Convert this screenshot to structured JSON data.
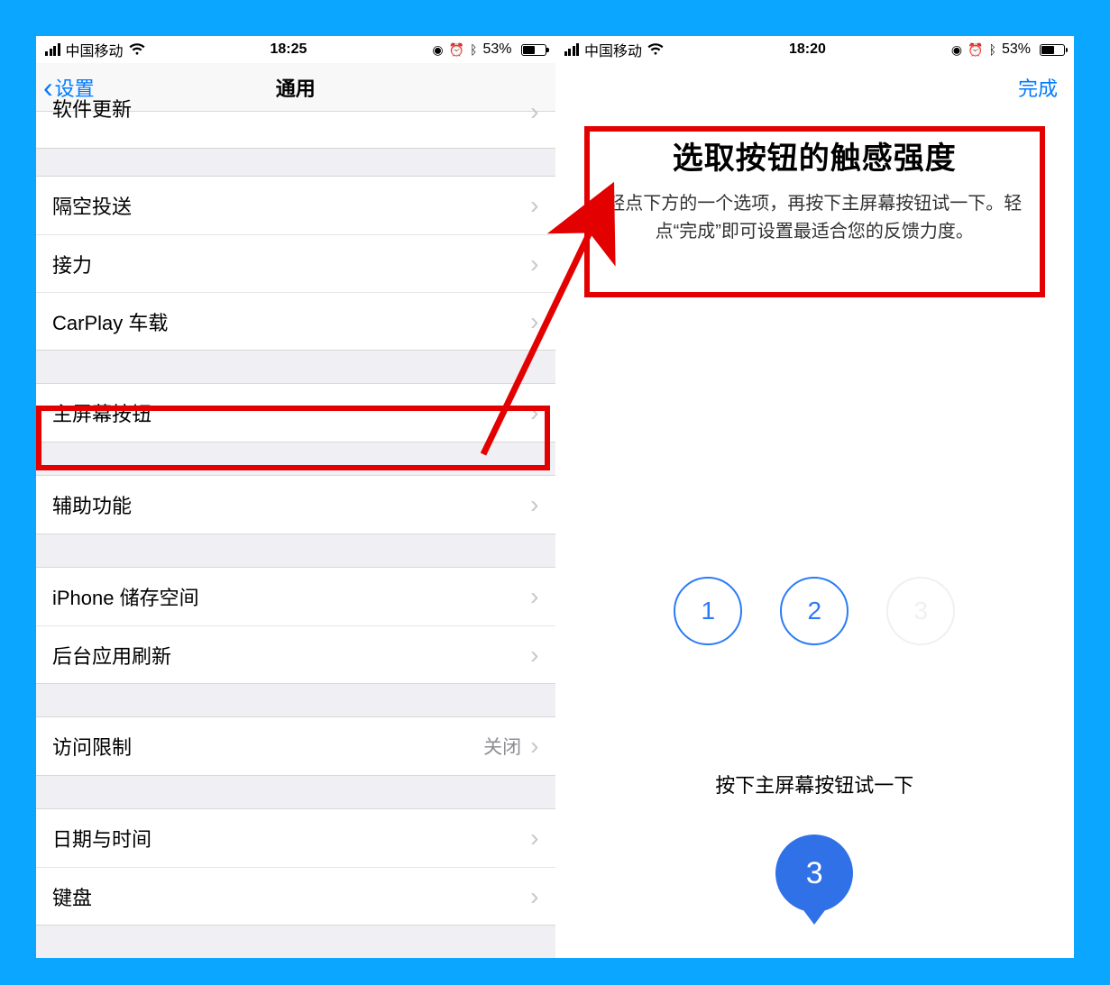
{
  "left": {
    "status": {
      "carrier": "中国移动",
      "time": "18:25",
      "battery_pct": "53%"
    },
    "nav": {
      "back_label": "设置",
      "title": "通用"
    },
    "groups": [
      {
        "rows": [
          {
            "label": "软件更新"
          }
        ]
      },
      {
        "rows": [
          {
            "label": "隔空投送"
          },
          {
            "label": "接力"
          },
          {
            "label": "CarPlay 车载"
          }
        ]
      },
      {
        "rows": [
          {
            "label": "主屏幕按钮"
          }
        ]
      },
      {
        "rows": [
          {
            "label": "辅助功能"
          }
        ]
      },
      {
        "rows": [
          {
            "label": "iPhone 储存空间"
          },
          {
            "label": "后台应用刷新"
          }
        ]
      },
      {
        "rows": [
          {
            "label": "访问限制",
            "value": "关闭"
          }
        ]
      },
      {
        "rows": [
          {
            "label": "日期与时间"
          },
          {
            "label": "键盘"
          }
        ]
      }
    ]
  },
  "right": {
    "status": {
      "carrier": "中国移动",
      "time": "18:20",
      "battery_pct": "53%"
    },
    "nav": {
      "done_label": "完成"
    },
    "haptic": {
      "title": "选取按钮的触感强度",
      "desc": "轻点下方的一个选项，再按下主屏幕按钮试一下。轻点“完成”即可设置最适合您的反馈力度。"
    },
    "options": {
      "o1": "1",
      "o2": "2",
      "o3": "3"
    },
    "prompt": "按下主屏幕按钮试一下",
    "selected": "3"
  },
  "annotation": {
    "arrow_color": "#e30000"
  }
}
